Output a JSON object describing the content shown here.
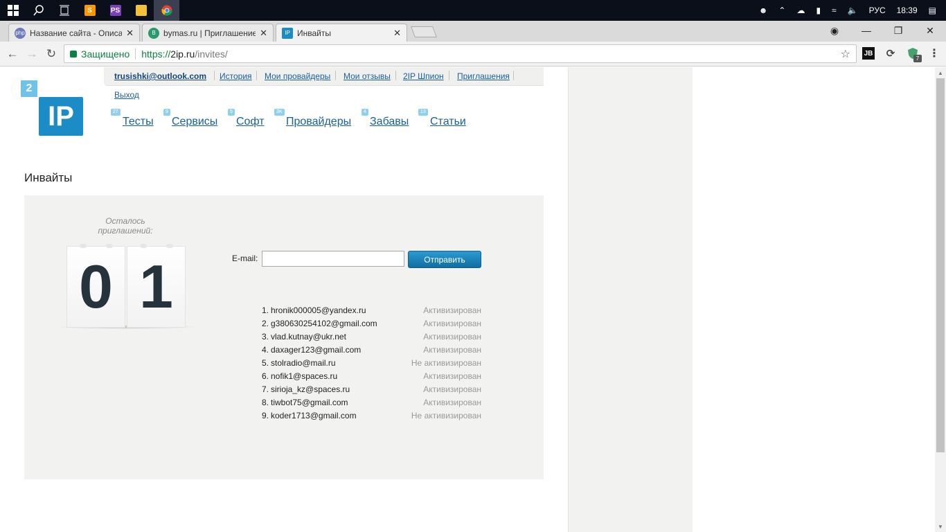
{
  "taskbar": {
    "tray": {
      "lang": "РУС",
      "time": "18:39"
    }
  },
  "tabs": [
    {
      "title": "Название сайта - Описа",
      "favicon": "php"
    },
    {
      "title": "bymas.ru | Приглашение",
      "favicon": "B"
    },
    {
      "title": "Инвайты",
      "favicon": "IP"
    }
  ],
  "toolbar": {
    "secure_label": "Защищено",
    "url_scheme": "https://",
    "url_host": "2ip.ru",
    "url_path": "/invites/",
    "ext_jb": "JB",
    "ext_badge": "7"
  },
  "logo": {
    "top": "2",
    "main": "IP"
  },
  "userbar": {
    "email": "trusishki@outlook.com",
    "links": [
      "История",
      "Мои провайдеры",
      "Мои отзывы",
      "2IP Шпион",
      "Приглашения"
    ],
    "logout": "Выход"
  },
  "menu": [
    {
      "label": "Тесты",
      "badge": "27"
    },
    {
      "label": "Сервисы",
      "badge": "9"
    },
    {
      "label": "Софт",
      "badge": "5"
    },
    {
      "label": "Провайдеры",
      "badge": "3K"
    },
    {
      "label": "Забавы",
      "badge": "4"
    },
    {
      "label": "Статьи",
      "badge": "13"
    }
  ],
  "page_title": "Инвайты",
  "invites": {
    "remaining_label": "Осталось приглашений:",
    "digits": [
      "0",
      "1"
    ],
    "email_label": "E-mail:",
    "email_value": "",
    "send_label": "Отправить",
    "list": [
      {
        "num": "1.",
        "email": "hronik000005@yandex.ru",
        "status": "Активизирован"
      },
      {
        "num": "2.",
        "email": "g380630254102@gmail.com",
        "status": "Активизирован"
      },
      {
        "num": "3.",
        "email": "vlad.kutnay@ukr.net",
        "status": "Активизирован"
      },
      {
        "num": "4.",
        "email": "daxager123@gmail.com",
        "status": "Активизирован"
      },
      {
        "num": "5.",
        "email": "stolradio@mail.ru",
        "status": "Не активизирован"
      },
      {
        "num": "6.",
        "email": "nofik1@spaces.ru",
        "status": "Активизирован"
      },
      {
        "num": "7.",
        "email": "sirioja_kz@spaces.ru",
        "status": "Активизирован"
      },
      {
        "num": "8.",
        "email": "tiwbot75@gmail.com",
        "status": "Активизирован"
      },
      {
        "num": "9.",
        "email": "koder1713@gmail.com",
        "status": "Не активизирован"
      }
    ]
  }
}
